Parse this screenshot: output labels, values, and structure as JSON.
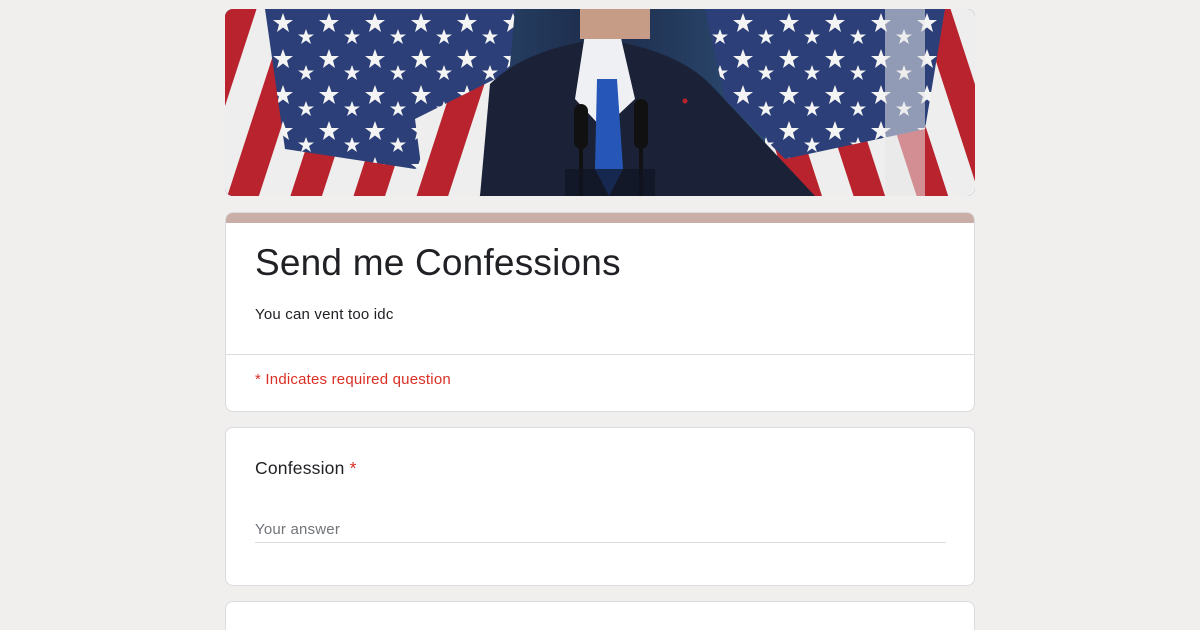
{
  "form": {
    "title": "Send me Confessions",
    "description": "You can vent too idc",
    "required_note": "* Indicates required question",
    "accent_color": "#c9ada7"
  },
  "banner": {
    "image": "header-image"
  },
  "questions": [
    {
      "label": "Confession",
      "required_mark": "*",
      "placeholder": "Your answer"
    }
  ],
  "colors": {
    "background": "#f1efed",
    "required": "#d93025",
    "text": "#202124"
  }
}
